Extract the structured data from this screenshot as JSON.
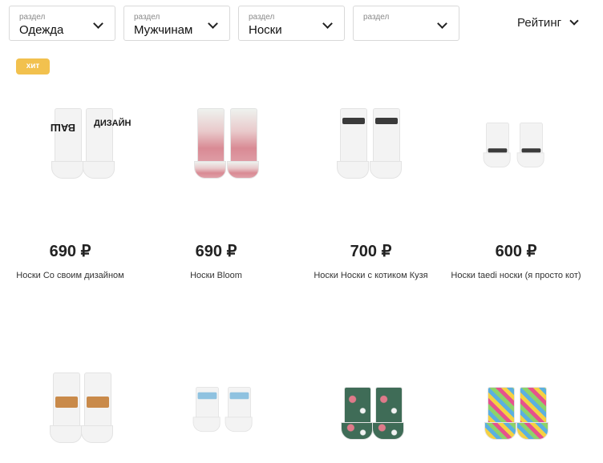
{
  "filters": [
    {
      "label": "раздел",
      "value": "Одежда"
    },
    {
      "label": "раздел",
      "value": "Мужчинам"
    },
    {
      "label": "раздел",
      "value": "Носки"
    },
    {
      "label": "раздел",
      "value": ""
    }
  ],
  "sort": {
    "value": "Рейтинг"
  },
  "badge": "хит",
  "products": [
    {
      "price": "690 ₽",
      "title": "Носки Со своим дизайном"
    },
    {
      "price": "690 ₽",
      "title": "Носки Bloom"
    },
    {
      "price": "700 ₽",
      "title": "Носки Носки с котиком Кузя"
    },
    {
      "price": "600 ₽",
      "title": "Носки taedi носки (я просто кот)"
    }
  ],
  "colors": {
    "badge": "#f2c14e",
    "border": "#d9d9d9"
  }
}
